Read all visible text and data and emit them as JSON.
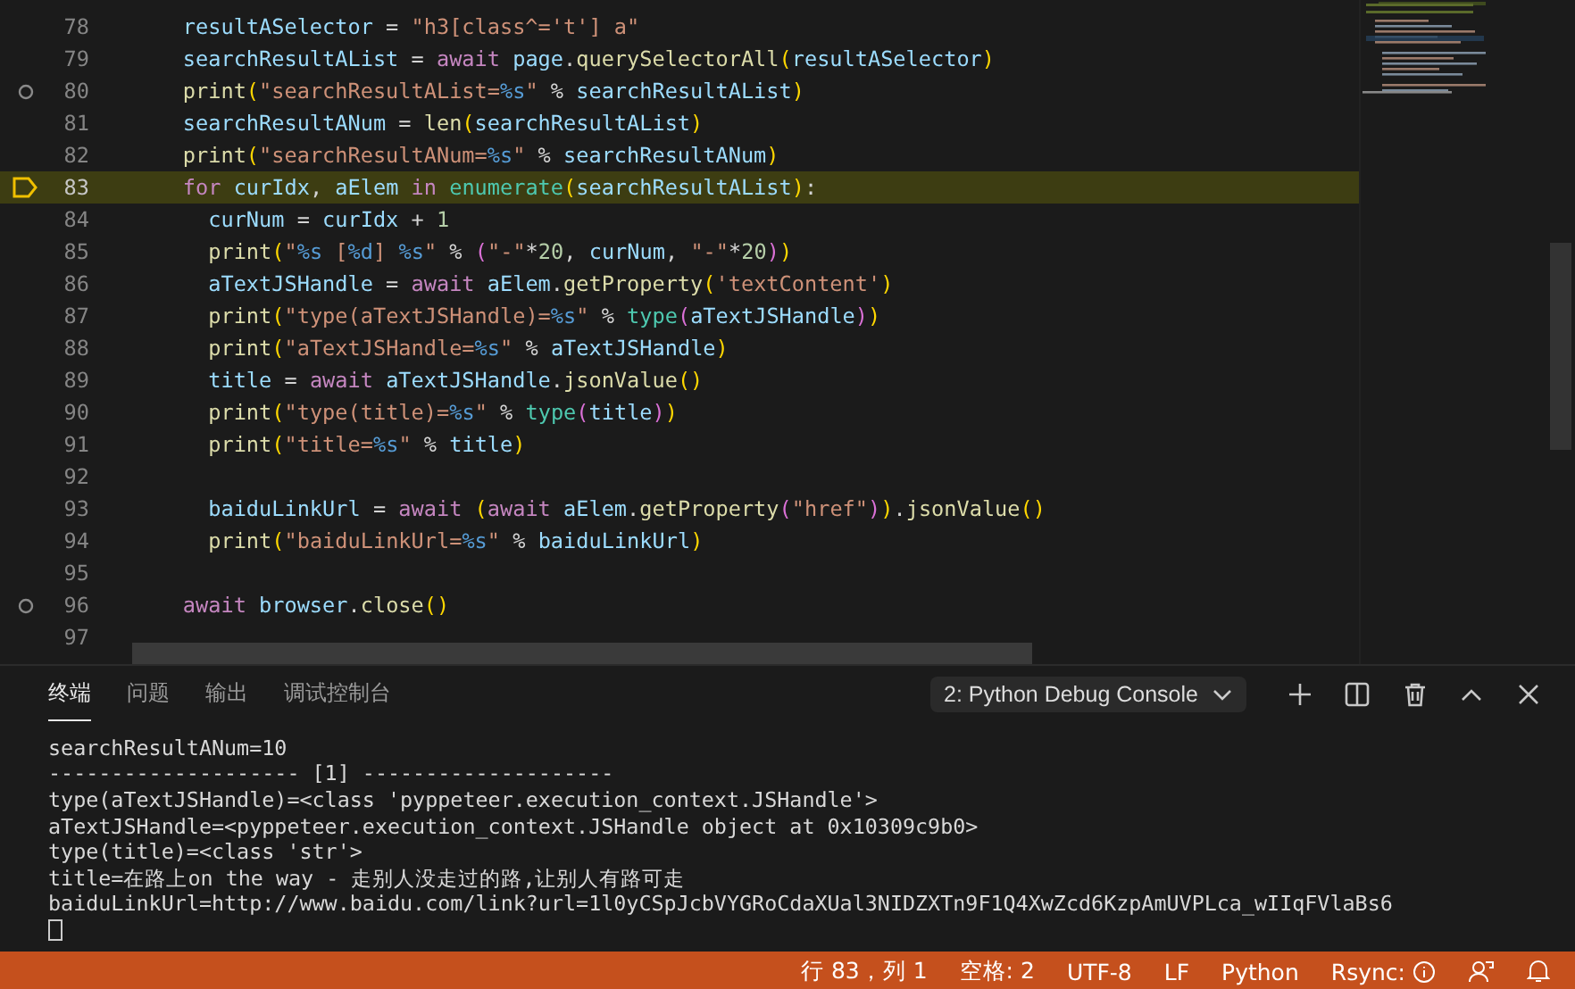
{
  "editor": {
    "lines": [
      {
        "number": "78",
        "breakpoint": false,
        "current": false,
        "tokens": [
          {
            "kind": "var",
            "text": "    resultASelector"
          },
          {
            "kind": "op",
            "text": " = "
          },
          {
            "kind": "str",
            "text": "\"h3[class^='t'] a\""
          }
        ]
      },
      {
        "number": "79",
        "breakpoint": false,
        "current": false,
        "tokens": [
          {
            "kind": "var",
            "text": "    searchResultAList"
          },
          {
            "kind": "op",
            "text": " = "
          },
          {
            "kind": "kw",
            "text": "await"
          },
          {
            "kind": "var",
            "text": " page"
          },
          {
            "kind": "op",
            "text": "."
          },
          {
            "kind": "fn",
            "text": "querySelectorAll"
          },
          {
            "kind": "br1",
            "text": "("
          },
          {
            "kind": "var",
            "text": "resultASelector"
          },
          {
            "kind": "br1",
            "text": ")"
          }
        ]
      },
      {
        "number": "80",
        "breakpoint": true,
        "current": false,
        "tokens": [
          {
            "kind": "fn",
            "text": "    print"
          },
          {
            "kind": "br1",
            "text": "("
          },
          {
            "kind": "str",
            "text": "\"searchResultAList="
          },
          {
            "kind": "fmt",
            "text": "%s"
          },
          {
            "kind": "str",
            "text": "\""
          },
          {
            "kind": "op",
            "text": " % "
          },
          {
            "kind": "var",
            "text": "searchResultAList"
          },
          {
            "kind": "br1",
            "text": ")"
          }
        ]
      },
      {
        "number": "81",
        "breakpoint": false,
        "current": false,
        "tokens": [
          {
            "kind": "var",
            "text": "    searchResultANum"
          },
          {
            "kind": "op",
            "text": " = "
          },
          {
            "kind": "fn",
            "text": "len"
          },
          {
            "kind": "br1",
            "text": "("
          },
          {
            "kind": "var",
            "text": "searchResultAList"
          },
          {
            "kind": "br1",
            "text": ")"
          }
        ]
      },
      {
        "number": "82",
        "breakpoint": false,
        "current": false,
        "tokens": [
          {
            "kind": "fn",
            "text": "    print"
          },
          {
            "kind": "br1",
            "text": "("
          },
          {
            "kind": "str",
            "text": "\"searchResultANum="
          },
          {
            "kind": "fmt",
            "text": "%s"
          },
          {
            "kind": "str",
            "text": "\""
          },
          {
            "kind": "op",
            "text": " % "
          },
          {
            "kind": "var",
            "text": "searchResultANum"
          },
          {
            "kind": "br1",
            "text": ")"
          }
        ]
      },
      {
        "number": "83",
        "breakpoint": false,
        "current": true,
        "tokens": [
          {
            "kind": "kw",
            "text": "    for"
          },
          {
            "kind": "var",
            "text": " curIdx"
          },
          {
            "kind": "op",
            "text": ", "
          },
          {
            "kind": "var",
            "text": "aElem"
          },
          {
            "kind": "kw",
            "text": " in "
          },
          {
            "kind": "type",
            "text": "enumerate"
          },
          {
            "kind": "br1",
            "text": "("
          },
          {
            "kind": "var",
            "text": "searchResultAList"
          },
          {
            "kind": "br1",
            "text": ")"
          },
          {
            "kind": "op",
            "text": ":"
          }
        ]
      },
      {
        "number": "84",
        "breakpoint": false,
        "current": false,
        "tokens": [
          {
            "kind": "var",
            "text": "      curNum"
          },
          {
            "kind": "op",
            "text": " = "
          },
          {
            "kind": "var",
            "text": "curIdx"
          },
          {
            "kind": "op",
            "text": " + "
          },
          {
            "kind": "num",
            "text": "1"
          }
        ]
      },
      {
        "number": "85",
        "breakpoint": false,
        "current": false,
        "tokens": [
          {
            "kind": "fn",
            "text": "      print"
          },
          {
            "kind": "br1",
            "text": "("
          },
          {
            "kind": "str",
            "text": "\""
          },
          {
            "kind": "fmt",
            "text": "%s"
          },
          {
            "kind": "str",
            "text": " ["
          },
          {
            "kind": "fmt",
            "text": "%d"
          },
          {
            "kind": "str",
            "text": "] "
          },
          {
            "kind": "fmt",
            "text": "%s"
          },
          {
            "kind": "str",
            "text": "\""
          },
          {
            "kind": "op",
            "text": " % "
          },
          {
            "kind": "br2",
            "text": "("
          },
          {
            "kind": "str",
            "text": "\"-\""
          },
          {
            "kind": "op",
            "text": "*"
          },
          {
            "kind": "num",
            "text": "20"
          },
          {
            "kind": "op",
            "text": ", "
          },
          {
            "kind": "var",
            "text": "curNum"
          },
          {
            "kind": "op",
            "text": ", "
          },
          {
            "kind": "str",
            "text": "\"-\""
          },
          {
            "kind": "op",
            "text": "*"
          },
          {
            "kind": "num",
            "text": "20"
          },
          {
            "kind": "br2",
            "text": ")"
          },
          {
            "kind": "br1",
            "text": ")"
          }
        ]
      },
      {
        "number": "86",
        "breakpoint": false,
        "current": false,
        "tokens": [
          {
            "kind": "var",
            "text": "      aTextJSHandle"
          },
          {
            "kind": "op",
            "text": " = "
          },
          {
            "kind": "kw",
            "text": "await"
          },
          {
            "kind": "var",
            "text": " aElem"
          },
          {
            "kind": "op",
            "text": "."
          },
          {
            "kind": "fn",
            "text": "getProperty"
          },
          {
            "kind": "br1",
            "text": "("
          },
          {
            "kind": "str",
            "text": "'textContent'"
          },
          {
            "kind": "br1",
            "text": ")"
          }
        ]
      },
      {
        "number": "87",
        "breakpoint": false,
        "current": false,
        "tokens": [
          {
            "kind": "fn",
            "text": "      print"
          },
          {
            "kind": "br1",
            "text": "("
          },
          {
            "kind": "str",
            "text": "\"type(aTextJSHandle)="
          },
          {
            "kind": "fmt",
            "text": "%s"
          },
          {
            "kind": "str",
            "text": "\""
          },
          {
            "kind": "op",
            "text": " % "
          },
          {
            "kind": "type",
            "text": "type"
          },
          {
            "kind": "br2",
            "text": "("
          },
          {
            "kind": "var",
            "text": "aTextJSHandle"
          },
          {
            "kind": "br2",
            "text": ")"
          },
          {
            "kind": "br1",
            "text": ")"
          }
        ]
      },
      {
        "number": "88",
        "breakpoint": false,
        "current": false,
        "tokens": [
          {
            "kind": "fn",
            "text": "      print"
          },
          {
            "kind": "br1",
            "text": "("
          },
          {
            "kind": "str",
            "text": "\"aTextJSHandle="
          },
          {
            "kind": "fmt",
            "text": "%s"
          },
          {
            "kind": "str",
            "text": "\""
          },
          {
            "kind": "op",
            "text": " % "
          },
          {
            "kind": "var",
            "text": "aTextJSHandle"
          },
          {
            "kind": "br1",
            "text": ")"
          }
        ]
      },
      {
        "number": "89",
        "breakpoint": false,
        "current": false,
        "tokens": [
          {
            "kind": "var",
            "text": "      title"
          },
          {
            "kind": "op",
            "text": " = "
          },
          {
            "kind": "kw",
            "text": "await"
          },
          {
            "kind": "var",
            "text": " aTextJSHandle"
          },
          {
            "kind": "op",
            "text": "."
          },
          {
            "kind": "fn",
            "text": "jsonValue"
          },
          {
            "kind": "br1",
            "text": "()"
          }
        ]
      },
      {
        "number": "90",
        "breakpoint": false,
        "current": false,
        "tokens": [
          {
            "kind": "fn",
            "text": "      print"
          },
          {
            "kind": "br1",
            "text": "("
          },
          {
            "kind": "str",
            "text": "\"type(title)="
          },
          {
            "kind": "fmt",
            "text": "%s"
          },
          {
            "kind": "str",
            "text": "\""
          },
          {
            "kind": "op",
            "text": " % "
          },
          {
            "kind": "type",
            "text": "type"
          },
          {
            "kind": "br2",
            "text": "("
          },
          {
            "kind": "var",
            "text": "title"
          },
          {
            "kind": "br2",
            "text": ")"
          },
          {
            "kind": "br1",
            "text": ")"
          }
        ]
      },
      {
        "number": "91",
        "breakpoint": false,
        "current": false,
        "tokens": [
          {
            "kind": "fn",
            "text": "      print"
          },
          {
            "kind": "br1",
            "text": "("
          },
          {
            "kind": "str",
            "text": "\"title="
          },
          {
            "kind": "fmt",
            "text": "%s"
          },
          {
            "kind": "str",
            "text": "\""
          },
          {
            "kind": "op",
            "text": " % "
          },
          {
            "kind": "var",
            "text": "title"
          },
          {
            "kind": "br1",
            "text": ")"
          }
        ]
      },
      {
        "number": "92",
        "breakpoint": false,
        "current": false
      },
      {
        "number": "93",
        "breakpoint": false,
        "current": false,
        "tokens": [
          {
            "kind": "var",
            "text": "      baiduLinkUrl"
          },
          {
            "kind": "op",
            "text": " = "
          },
          {
            "kind": "kw",
            "text": "await"
          },
          {
            "kind": "br1",
            "text": " ("
          },
          {
            "kind": "kw",
            "text": "await"
          },
          {
            "kind": "var",
            "text": " aElem"
          },
          {
            "kind": "op",
            "text": "."
          },
          {
            "kind": "fn",
            "text": "getProperty"
          },
          {
            "kind": "br2",
            "text": "("
          },
          {
            "kind": "str",
            "text": "\"href\""
          },
          {
            "kind": "br2",
            "text": ")"
          },
          {
            "kind": "br1",
            "text": ")"
          },
          {
            "kind": "op",
            "text": "."
          },
          {
            "kind": "fn",
            "text": "jsonValue"
          },
          {
            "kind": "br1",
            "text": "()"
          }
        ]
      },
      {
        "number": "94",
        "breakpoint": false,
        "current": false,
        "tokens": [
          {
            "kind": "fn",
            "text": "      print"
          },
          {
            "kind": "br1",
            "text": "("
          },
          {
            "kind": "str",
            "text": "\"baiduLinkUrl="
          },
          {
            "kind": "fmt",
            "text": "%s"
          },
          {
            "kind": "str",
            "text": "\""
          },
          {
            "kind": "op",
            "text": " % "
          },
          {
            "kind": "var",
            "text": "baiduLinkUrl"
          },
          {
            "kind": "br1",
            "text": ")"
          }
        ]
      },
      {
        "number": "95",
        "breakpoint": false,
        "current": false
      },
      {
        "number": "96",
        "breakpoint": true,
        "current": false,
        "tokens": [
          {
            "kind": "kw",
            "text": "    await"
          },
          {
            "kind": "var",
            "text": " browser"
          },
          {
            "kind": "op",
            "text": "."
          },
          {
            "kind": "fn",
            "text": "close"
          },
          {
            "kind": "br1",
            "text": "()"
          }
        ]
      },
      {
        "number": "97",
        "breakpoint": false,
        "current": false
      }
    ]
  },
  "panel": {
    "tabs": [
      {
        "label": "终端",
        "selected": true
      },
      {
        "label": "问题",
        "selected": false
      },
      {
        "label": "输出",
        "selected": false
      },
      {
        "label": "调试控制台",
        "selected": false
      }
    ],
    "console_select": "2: Python Debug Console",
    "terminal_lines": [
      "searchResultANum=10",
      "-------------------- [1] --------------------",
      "type(aTextJSHandle)=<class 'pyppeteer.execution_context.JSHandle'>",
      "aTextJSHandle=<pyppeteer.execution_context.JSHandle object at 0x10309c9b0>",
      "type(title)=<class 'str'>",
      "title=在路上on the way - 走别人没走过的路,让别人有路可走",
      "baiduLinkUrl=http://www.baidu.com/link?url=1l0yCSpJcbVYGRoCdaXUal3NIDZXTn9F1Q4XwZcd6KzpAmUVPLca_wIIqFVlaBs6"
    ]
  },
  "status_bar": {
    "items": [
      "行 83，列 1",
      "空格: 2",
      "UTF-8",
      "LF",
      "Python",
      "Rsync:"
    ]
  }
}
